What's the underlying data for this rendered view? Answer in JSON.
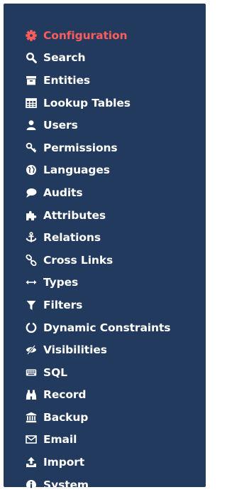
{
  "colors": {
    "sidebar_background": "#223a5e",
    "label": "#ffffff",
    "active": "#ff5c5c"
  },
  "menu": {
    "items": [
      {
        "label": "Configuration",
        "icon": "gear-icon",
        "active": true
      },
      {
        "label": "Search",
        "icon": "search-icon",
        "active": false
      },
      {
        "label": "Entities",
        "icon": "entity-box-icon",
        "active": false
      },
      {
        "label": "Lookup Tables",
        "icon": "table-icon",
        "active": false
      },
      {
        "label": "Users",
        "icon": "user-icon",
        "active": false
      },
      {
        "label": "Permissions",
        "icon": "key-icon",
        "active": false
      },
      {
        "label": "Languages",
        "icon": "globe-icon",
        "active": false
      },
      {
        "label": "Audits",
        "icon": "speech-bubble-icon",
        "active": false
      },
      {
        "label": "Attributes",
        "icon": "puzzle-icon",
        "active": false
      },
      {
        "label": "Relations",
        "icon": "anchor-icon",
        "active": false
      },
      {
        "label": "Cross Links",
        "icon": "link-icon",
        "active": false
      },
      {
        "label": "Types",
        "icon": "horizontal-arrows-icon",
        "active": false
      },
      {
        "label": "Filters",
        "icon": "filter-icon",
        "active": false
      },
      {
        "label": "Dynamic Constraints",
        "icon": "circle-notch-icon",
        "active": false
      },
      {
        "label": "Visibilities",
        "icon": "eye-slash-icon",
        "active": false
      },
      {
        "label": "SQL",
        "icon": "keyboard-icon",
        "active": false
      },
      {
        "label": "Record",
        "icon": "binoculars-icon",
        "active": false
      },
      {
        "label": "Backup",
        "icon": "bank-icon",
        "active": false
      },
      {
        "label": "Email",
        "icon": "envelope-icon",
        "active": false
      },
      {
        "label": "Import",
        "icon": "upload-icon",
        "active": false
      },
      {
        "label": "System",
        "icon": "info-circle-icon",
        "active": false
      }
    ]
  }
}
